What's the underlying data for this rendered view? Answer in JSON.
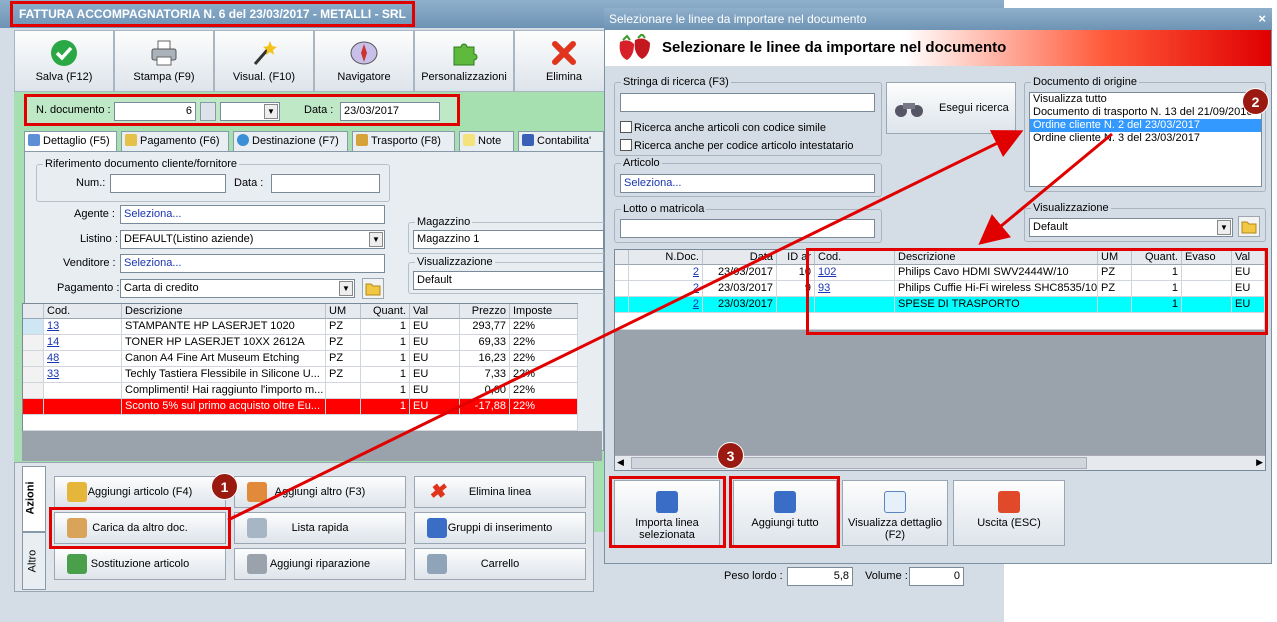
{
  "main": {
    "title": "FATTURA ACCOMPAGNATORIA N. 6 del 23/03/2017 - METALLI - SRL",
    "toolbar": [
      {
        "label": "Salva (F12)",
        "icon": "check-icon"
      },
      {
        "label": "Stampa (F9)",
        "icon": "printer-icon"
      },
      {
        "label": "Visual. (F10)",
        "icon": "magic-wand-icon"
      },
      {
        "label": "Navigatore",
        "icon": "compass-icon"
      },
      {
        "label": "Personalizzazioni",
        "icon": "puzzle-icon"
      },
      {
        "label": "Elimina",
        "icon": "delete-x-icon"
      }
    ],
    "doc": {
      "num_label": "N. documento :",
      "num_value": "6",
      "date_label": "Data :",
      "date_value": "23/03/2017"
    },
    "tabs": [
      "Dettaglio (F5)",
      "Pagamento (F6)",
      "Destinazione (F7)",
      "Trasporto (F8)",
      "Note",
      "Contabilita'"
    ],
    "ref": {
      "legend": "Riferimento documento cliente/fornitore",
      "num_label": "Num.:",
      "date_label": "Data :"
    },
    "fields": {
      "agente_label": "Agente :",
      "agente_value": "Seleziona...",
      "listino_label": "Listino :",
      "listino_value": "DEFAULT(Listino aziende)",
      "venditore_label": "Venditore :",
      "venditore_value": "Seleziona...",
      "pagamento_label": "Pagamento :",
      "pagamento_value": "Carta di credito"
    },
    "magazzino": {
      "legend": "Magazzino",
      "value": "Magazzino 1"
    },
    "visual": {
      "legend": "Visualizzazione",
      "value": "Default"
    },
    "grid": {
      "headers": [
        "Cod.",
        "Descrizione",
        "UM",
        "Quant.",
        "Val",
        "Prezzo",
        "Imposte"
      ],
      "rows": [
        [
          "13",
          "STAMPANTE HP LASERJET 1020",
          "PZ",
          "1",
          "EU",
          "293,77",
          "22%"
        ],
        [
          "14",
          "TONER HP LASERJET 10XX 2612A",
          "PZ",
          "1",
          "EU",
          "69,33",
          "22%"
        ],
        [
          "48",
          "Canon A4 Fine Art Museum Etching",
          "PZ",
          "1",
          "EU",
          "16,23",
          "22%"
        ],
        [
          "33",
          "Techly Tastiera Flessibile in Silicone U...",
          "PZ",
          "1",
          "EU",
          "7,33",
          "22%"
        ],
        [
          "",
          "Complimenti! Hai raggiunto l'importo m...",
          "",
          "1",
          "EU",
          "0,00",
          "22%"
        ],
        [
          "",
          "Sconto 5% sul primo acquisto oltre Eu...",
          "",
          "1",
          "EU",
          "-17,88",
          "22%"
        ]
      ]
    },
    "side_tabs": [
      "Azioni",
      "Altro"
    ],
    "actions": [
      "Aggiungi articolo (F4)",
      "Aggiungi altro (F3)",
      "Elimina linea",
      "Carica da altro doc.",
      "Lista rapida",
      "Gruppi di inserimento",
      "Sostituzione articolo",
      "Aggiungi riparazione",
      "Carrello"
    ],
    "footer": {
      "peso_label": "Peso lordo :",
      "peso_value": "5,8",
      "volume_label": "Volume :",
      "volume_value": "0"
    }
  },
  "dialog": {
    "title": "Selezionare le linee da importare nel documento",
    "close": "×",
    "banner": "Selezionare le linee da importare nel documento",
    "search_legend": "Stringa di ricerca (F3)",
    "chk1": "Ricerca anche articoli con codice simile",
    "chk2": "Ricerca anche per codice articolo intestatario",
    "search_btn": "Esegui ricerca",
    "articolo_legend": "Articolo",
    "articolo_value": "Seleziona...",
    "lotto_legend": "Lotto o matricola",
    "origin_legend": "Documento di origine",
    "origin_items": [
      "Visualizza tutto",
      "Documento di trasporto N. 13 del 21/09/2016",
      "Ordine cliente N. 2 del 23/03/2017",
      "Ordine cliente N. 3 del 23/03/2017"
    ],
    "visual_legend": "Visualizzazione",
    "visual_value": "Default",
    "grid": {
      "headers": [
        "N.Doc.",
        "Data",
        "ID ar",
        "Cod.",
        "Descrizione",
        "UM",
        "Quant.",
        "Evaso",
        "Val"
      ],
      "rows": [
        [
          "2",
          "23/03/2017",
          "10",
          "102",
          "Philips Cavo HDMI SWV2444W/10",
          "PZ",
          "1",
          "",
          "EU"
        ],
        [
          "2",
          "23/03/2017",
          "9",
          "93",
          "Philips Cuffie Hi-Fi wireless SHC8535/10",
          "PZ",
          "1",
          "",
          "EU"
        ],
        [
          "2",
          "23/03/2017",
          "",
          "",
          "SPESE DI TRASPORTO",
          "",
          "1",
          "",
          "EU"
        ]
      ]
    },
    "buttons": [
      "Importa linea selezionata",
      "Aggiungi tutto",
      "Visualizza dettaglio (F2)",
      "Uscita (ESC)"
    ]
  },
  "badges": [
    "1",
    "2",
    "3"
  ],
  "colors": {
    "highlight_red": "#e00000",
    "selected_row": "#ff0000",
    "cyan_row": "#00ffff",
    "green_panel": "#a6dfb0"
  }
}
